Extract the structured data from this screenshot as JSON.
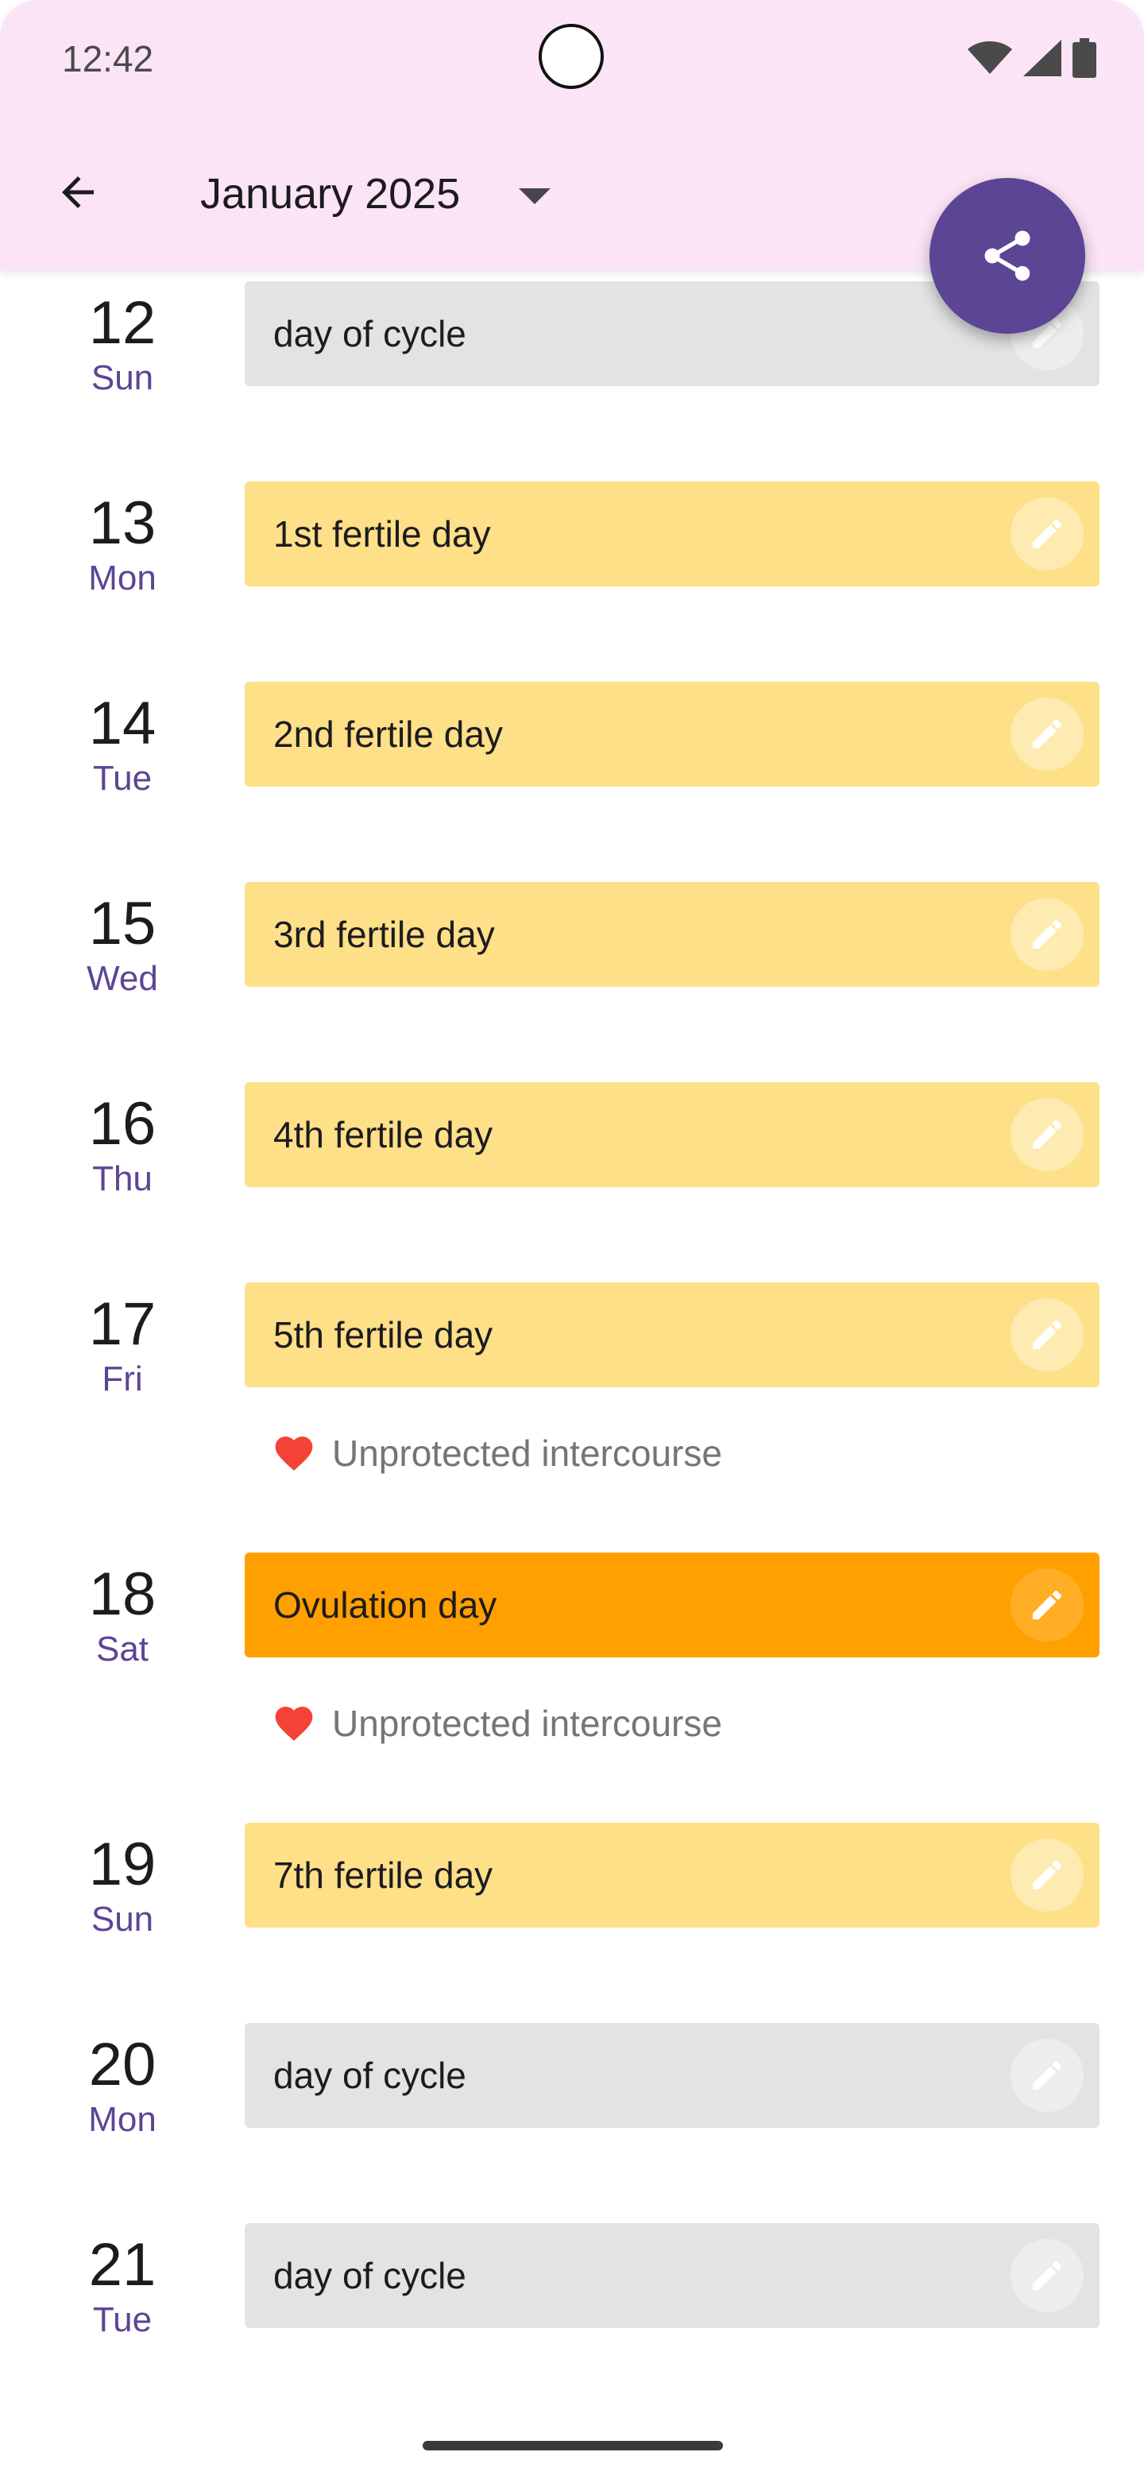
{
  "status_bar": {
    "time": "12:42",
    "icons": [
      "wifi-icon",
      "cellular-signal-icon",
      "battery-icon"
    ]
  },
  "app_bar": {
    "back_icon": "arrow-back-icon",
    "month_label": "January 2025",
    "dropdown_icon": "dropdown-arrow-icon",
    "share_icon": "share-icon"
  },
  "colors": {
    "app_bar_bg": "#fbe4f5",
    "accent": "#5d4595",
    "day_of_cycle": "#e3e3e3",
    "fertile_day": "#fde087",
    "ovulation_day": "#ffa000",
    "heart": "#f44336"
  },
  "days": [
    {
      "date": "12",
      "dow": "Sun",
      "label": "day of cycle",
      "kind": "cycle"
    },
    {
      "date": "13",
      "dow": "Mon",
      "label": "1st fertile day",
      "kind": "fertile"
    },
    {
      "date": "14",
      "dow": "Tue",
      "label": "2nd fertile day",
      "kind": "fertile"
    },
    {
      "date": "15",
      "dow": "Wed",
      "label": "3rd fertile day",
      "kind": "fertile"
    },
    {
      "date": "16",
      "dow": "Thu",
      "label": "4th fertile day",
      "kind": "fertile"
    },
    {
      "date": "17",
      "dow": "Fri",
      "label": "5th fertile day",
      "kind": "fertile",
      "note": "Unprotected intercourse"
    },
    {
      "date": "18",
      "dow": "Sat",
      "label": "Ovulation day",
      "kind": "ovulation",
      "note": "Unprotected intercourse"
    },
    {
      "date": "19",
      "dow": "Sun",
      "label": "7th fertile day",
      "kind": "fertile"
    },
    {
      "date": "20",
      "dow": "Mon",
      "label": "day of cycle",
      "kind": "cycle"
    },
    {
      "date": "21",
      "dow": "Tue",
      "label": "day of cycle",
      "kind": "cycle"
    }
  ]
}
